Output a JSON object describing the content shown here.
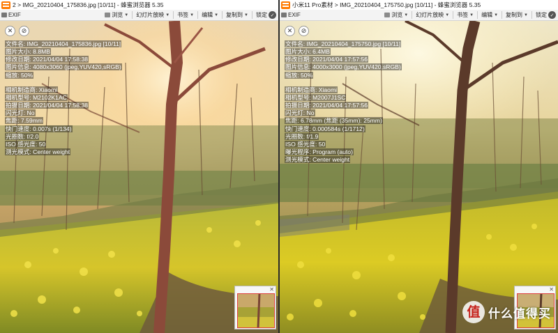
{
  "theme": {
    "app_icon_color": "#ff7a00",
    "accent": "#ff7a00"
  },
  "windows": [
    {
      "id": "left",
      "title": "2 > IMG_20210404_175836.jpg [10/11] - 蜂蜜浏览器 5.35",
      "toolbar": {
        "exif_label": "EXIF",
        "browse_label": "浏览",
        "slideshow_label": "幻灯片放映",
        "bookmark_label": "书签",
        "edit_label": "编辑",
        "copy_to_label": "复制到",
        "lock_label": "锁定"
      },
      "exif": [
        "文件名: IMG_20210404_175836.jpg [10/11]",
        "图片大小: 8.8MB",
        "修改日期: 2021/04/04 17:58:38",
        "图片信息: 4080x3060 (jpeg,YUV420,sRGB)",
        "缩放: 50%",
        "",
        "相机制造商: Xiaomi",
        "相机型号: M2102K1AC",
        "拍摄日期: 2021/04/04 17:58:38",
        "闪光灯: No",
        "焦距: 7.59mm",
        "快门速度: 0.007s (1/134)",
        "光圈数: f/2.0",
        "ISO 感光度: 50",
        "测光模式: Center weight"
      ]
    },
    {
      "id": "right",
      "title": "小米11 Pro素材 > IMG_20210404_175750.jpg [10/11] - 蜂蜜浏览器 5.35",
      "toolbar": {
        "exif_label": "EXIF",
        "browse_label": "浏览",
        "slideshow_label": "幻灯片放映",
        "bookmark_label": "书签",
        "edit_label": "编辑",
        "copy_to_label": "复制到",
        "lock_label": "锁定"
      },
      "exif": [
        "文件名: IMG_20210404_175750.jpg [10/11]",
        "图片大小: 6.4MB",
        "修改日期: 2021/04/04 17:57:56",
        "图片信息: 4000x3000 (jpeg,YUV420,sRGB)",
        "缩放: 50%",
        "",
        "相机制造商: Xiaomi",
        "相机型号: M2007J1SC",
        "拍摄日期: 2021/04/04 17:57:56",
        "闪光灯: No",
        "焦距: 6.78mm (焦距 (35mm): 25mm)",
        "快门速度: 0.000584s (1/1712)",
        "光圈数: f/1.9",
        "ISO 感光度: 50",
        "曝光程序: Program (auto)",
        "测光模式: Center weight"
      ],
      "watermark": {
        "logo_char": "值",
        "text": "什么值得买"
      }
    }
  ]
}
